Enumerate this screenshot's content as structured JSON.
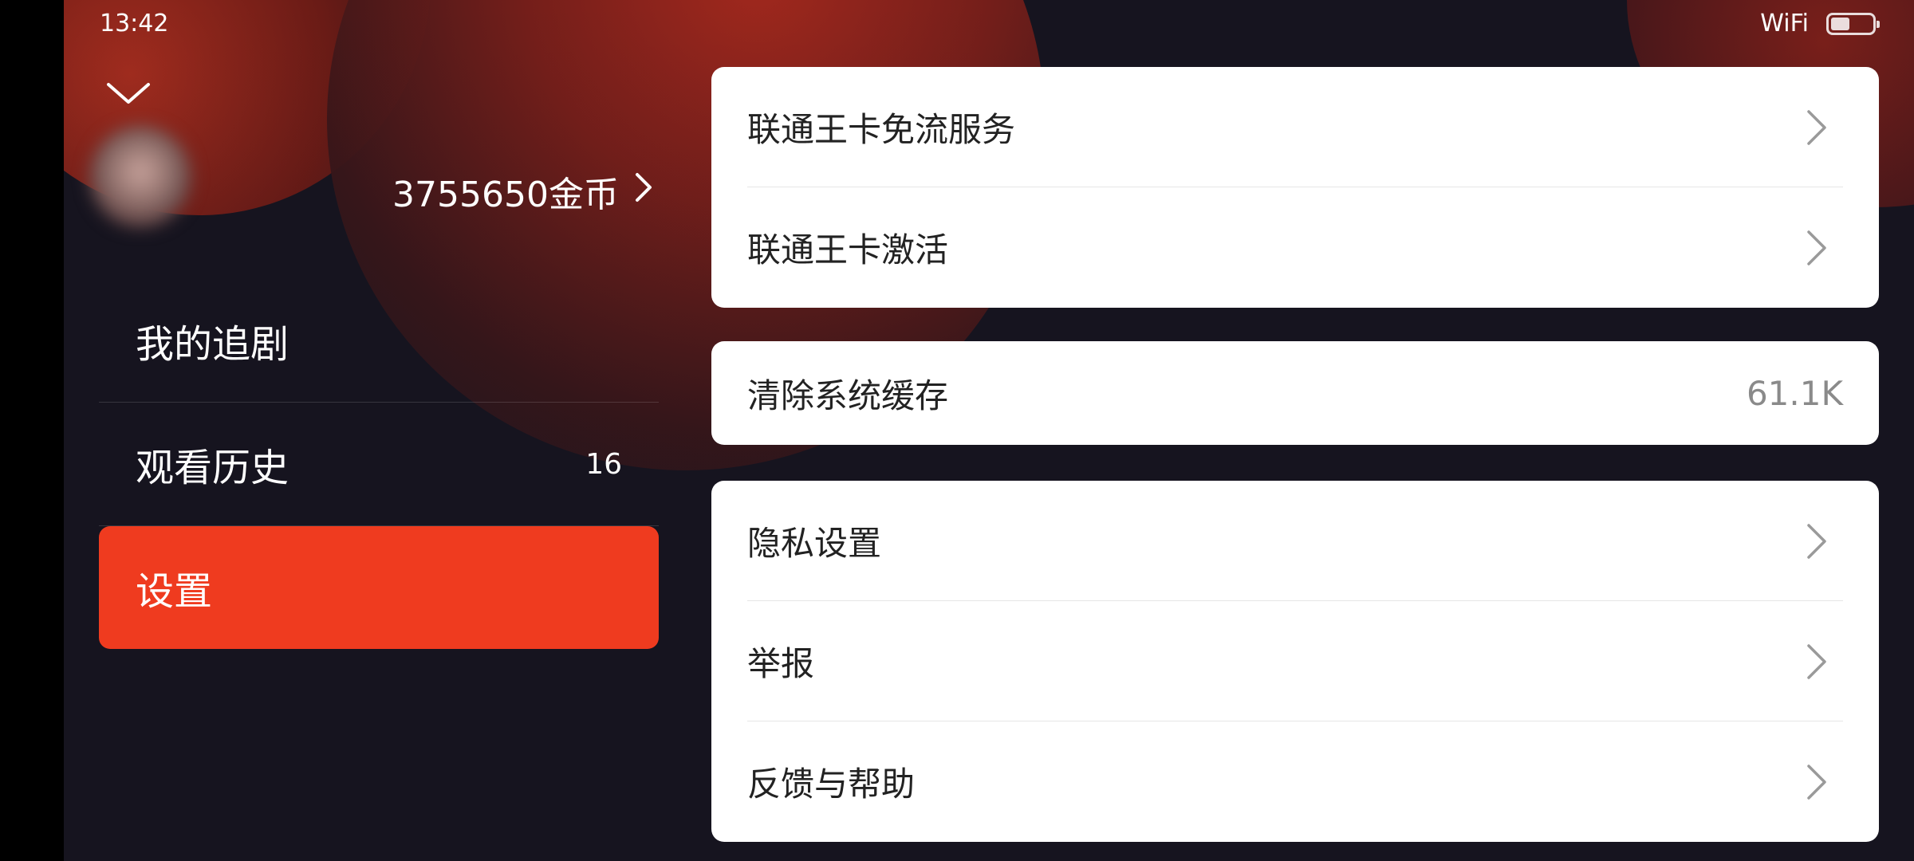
{
  "status_bar": {
    "time": "13:42",
    "network": "WiFi",
    "battery_level": 0.45
  },
  "profile": {
    "coins_text": "3755650金币",
    "collapse_icon": "chevron-down-icon"
  },
  "nav": {
    "items": [
      {
        "label": "我的追剧",
        "count": ""
      },
      {
        "label": "观看历史",
        "count": "16"
      },
      {
        "label": "设置",
        "count": "",
        "active": true
      }
    ]
  },
  "settings": {
    "card1": [
      {
        "label": "联通王卡免流服务"
      },
      {
        "label": "联通王卡激活"
      }
    ],
    "card2": [
      {
        "label": "清除系统缓存",
        "value": "61.1K"
      }
    ],
    "card3": [
      {
        "label": "隐私设置"
      },
      {
        "label": "举报"
      },
      {
        "label": "反馈与帮助"
      }
    ]
  },
  "colors": {
    "accent": "#ef3b1f",
    "background": "#16141f",
    "card": "#ffffff"
  }
}
